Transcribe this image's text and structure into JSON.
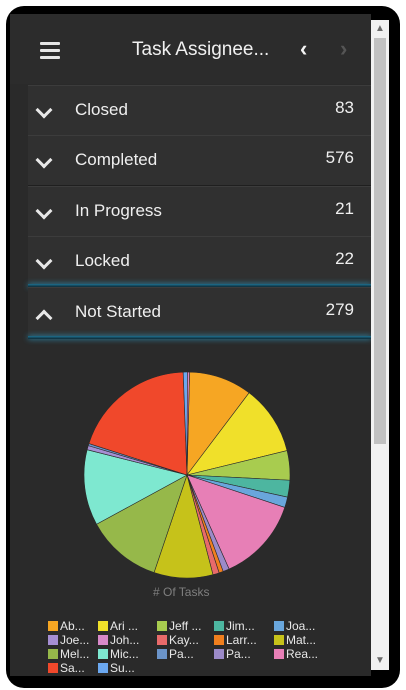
{
  "header": {
    "title": "Task Assignee...",
    "prev_icon": "chevron-left-icon",
    "next_icon": "chevron-right-icon",
    "menu_icon": "hamburger-menu-icon"
  },
  "groups": [
    {
      "label": "Closed",
      "count": "83",
      "expanded": false
    },
    {
      "label": "Completed",
      "count": "576",
      "expanded": false
    },
    {
      "label": "In Progress",
      "count": "21",
      "expanded": false
    },
    {
      "label": "Locked",
      "count": "22",
      "expanded": false
    },
    {
      "label": "Not Started",
      "count": "279",
      "expanded": true
    }
  ],
  "chart": {
    "metric_label": "# Of Tasks"
  },
  "chart_data": {
    "type": "pie",
    "slices": [
      {
        "name": "Ab...",
        "value": 30,
        "color": "#f6a623"
      },
      {
        "name": "Ari ...",
        "value": 33,
        "color": "#f0e02a"
      },
      {
        "name": "Jeff ...",
        "value": 14,
        "color": "#a8cc4f"
      },
      {
        "name": "Jim...",
        "value": 8,
        "color": "#4db6a0"
      },
      {
        "name": "Joa...",
        "value": 5,
        "color": "#69a6dc"
      },
      {
        "name": "Rea...",
        "value": 40,
        "color": "#e77fb6"
      },
      {
        "name": "Pa...",
        "value": 3,
        "color": "#9b8ac8"
      },
      {
        "name": "Larr...",
        "value": 2,
        "color": "#f07f1e"
      },
      {
        "name": "Kay...",
        "value": 3,
        "color": "#e86a6a"
      },
      {
        "name": "Mat...",
        "value": 28,
        "color": "#c6c21a"
      },
      {
        "name": "Mel...",
        "value": 36,
        "color": "#96b84a"
      },
      {
        "name": "Mic...",
        "value": 36,
        "color": "#7ee8d0"
      },
      {
        "name": "Joe...",
        "value": 2,
        "color": "#a68fd3"
      },
      {
        "name": "Pa...",
        "value": 1,
        "color": "#6b94c9"
      },
      {
        "name": "Sa...",
        "value": 59,
        "color": "#f0482b"
      },
      {
        "name": "Su...",
        "value": 2,
        "color": "#6ba8f0"
      },
      {
        "name": "Joh...",
        "value": 1,
        "color": "#d889c9"
      }
    ]
  },
  "legend": [
    {
      "label": "Ab...",
      "color": "#f6a623"
    },
    {
      "label": "Ari ...",
      "color": "#f0e02a"
    },
    {
      "label": "Jeff ...",
      "color": "#a8cc4f"
    },
    {
      "label": "Jim...",
      "color": "#4db6a0"
    },
    {
      "label": "Joa...",
      "color": "#69a6dc"
    },
    {
      "label": "Joe...",
      "color": "#a68fd3"
    },
    {
      "label": "Joh...",
      "color": "#d889c9"
    },
    {
      "label": "Kay...",
      "color": "#e86a6a"
    },
    {
      "label": "Larr...",
      "color": "#f07f1e"
    },
    {
      "label": "Mat...",
      "color": "#c6c21a"
    },
    {
      "label": "Mel...",
      "color": "#96b84a"
    },
    {
      "label": "Mic...",
      "color": "#7ee8d0"
    },
    {
      "label": "Pa...",
      "color": "#6b94c9"
    },
    {
      "label": "Pa...",
      "color": "#9b8ac8"
    },
    {
      "label": "Rea...",
      "color": "#e77fb6"
    },
    {
      "label": "Sa...",
      "color": "#f0482b"
    },
    {
      "label": "Su...",
      "color": "#6ba8f0"
    }
  ]
}
